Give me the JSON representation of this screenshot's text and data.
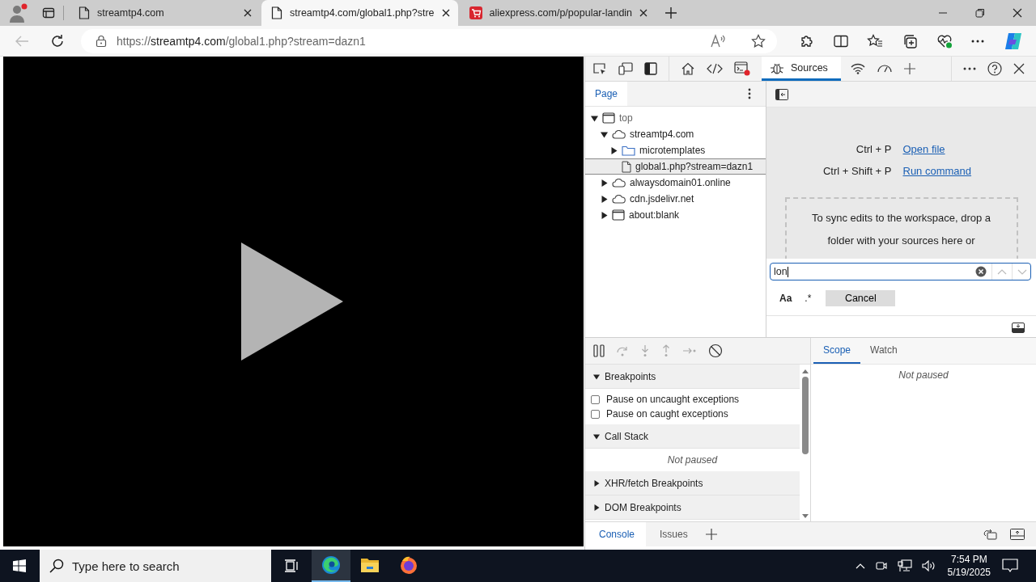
{
  "browser": {
    "tabs": [
      {
        "title": "streamtp4.com",
        "kind": "page",
        "selected": false
      },
      {
        "title": "streamtp4.com/global1.php?stre",
        "kind": "page",
        "selected": true
      },
      {
        "title": "aliexpress.com/p/popular-landin",
        "kind": "shop",
        "selected": false
      }
    ],
    "address": {
      "scheme": "https://",
      "host": "streamtp4.com",
      "path": "/global1.php?stream=dazn1"
    }
  },
  "devtools": {
    "panel_tab": {
      "label": "Sources",
      "selected": true
    },
    "navigator": {
      "tab": {
        "label": "Page",
        "selected": true
      },
      "tree": [
        {
          "kind": "frame",
          "label": "top",
          "expanded": true,
          "selected": false,
          "children": [
            {
              "kind": "domain",
              "label": "streamtp4.com",
              "expanded": true,
              "selected": false,
              "children": [
                {
                  "kind": "folder",
                  "label": "microtemplates",
                  "expanded": false,
                  "selected": false
                },
                {
                  "kind": "file",
                  "label": "global1.php?stream=dazn1",
                  "selected": true
                }
              ]
            },
            {
              "kind": "domain",
              "label": "alwaysdomain01.online",
              "expanded": false,
              "selected": false
            },
            {
              "kind": "domain",
              "label": "cdn.jsdelivr.net",
              "expanded": false,
              "selected": false
            },
            {
              "kind": "frame",
              "label": "about:blank",
              "expanded": false,
              "selected": false
            }
          ]
        }
      ]
    },
    "drawer": {
      "tabs": [
        {
          "label": "Console",
          "selected": true
        },
        {
          "label": "Issues",
          "selected": false
        }
      ]
    }
  },
  "editor": {
    "shortcuts": [
      {
        "keys": "Ctrl + P",
        "action": "Open file"
      },
      {
        "keys": "Ctrl + Shift + P",
        "action": "Run command"
      }
    ],
    "drop_hint": "To sync edits to the workspace, drop a folder with your sources here or"
  },
  "search": {
    "value": "lon",
    "match_case": {
      "label": "Aa",
      "on": false
    },
    "regex": {
      "label": ".*",
      "on": false
    },
    "cancel": "Cancel"
  },
  "debugger": {
    "sections": [
      {
        "title": "Breakpoints",
        "expanded": true,
        "checkboxes": [
          {
            "label": "Pause on uncaught exceptions",
            "checked": false
          },
          {
            "label": "Pause on caught exceptions",
            "checked": false
          }
        ]
      },
      {
        "title": "Call Stack",
        "expanded": true,
        "message": "Not paused"
      },
      {
        "title": "XHR/fetch Breakpoints",
        "expanded": false
      },
      {
        "title": "DOM Breakpoints",
        "expanded": false
      }
    ],
    "side_tabs": [
      {
        "label": "Scope",
        "selected": true
      },
      {
        "label": "Watch",
        "selected": false
      }
    ],
    "side_message": "Not paused"
  },
  "taskbar": {
    "search_placeholder": "Type here to search",
    "apps": [
      {
        "kind": "edge",
        "active": true
      },
      {
        "kind": "explorer",
        "active": false
      },
      {
        "kind": "firefox",
        "active": false
      }
    ],
    "time": "7:54 PM",
    "date": "5/19/2025"
  }
}
